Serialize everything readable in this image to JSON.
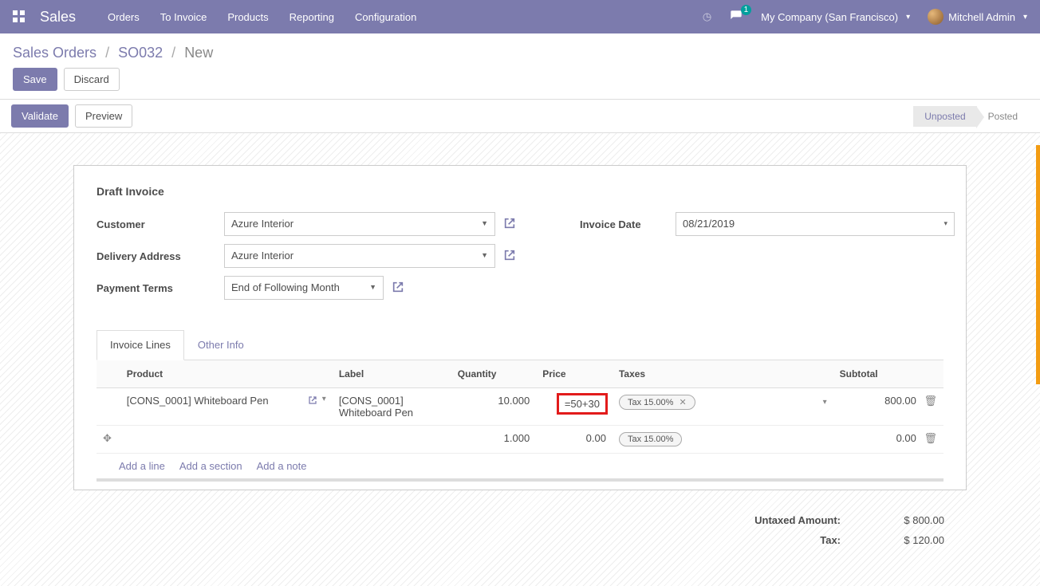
{
  "navbar": {
    "brand": "Sales",
    "menu": [
      "Orders",
      "To Invoice",
      "Products",
      "Reporting",
      "Configuration"
    ],
    "chat_badge": "1",
    "company": "My Company (San Francisco)",
    "user": "Mitchell Admin"
  },
  "breadcrumb": {
    "root": "Sales Orders",
    "so": "SO032",
    "current": "New"
  },
  "controls": {
    "save": "Save",
    "discard": "Discard"
  },
  "status": {
    "validate": "Validate",
    "preview": "Preview",
    "unposted": "Unposted",
    "posted": "Posted"
  },
  "sheet": {
    "title": "Draft Invoice",
    "labels": {
      "customer": "Customer",
      "delivery": "Delivery Address",
      "terms": "Payment Terms",
      "invoice_date": "Invoice Date"
    },
    "fields": {
      "customer": "Azure Interior",
      "delivery": "Azure Interior",
      "terms": "End of Following Month",
      "invoice_date": "08/21/2019"
    }
  },
  "tabs": {
    "lines": "Invoice Lines",
    "other": "Other Info"
  },
  "table": {
    "headers": {
      "product": "Product",
      "label": "Label",
      "quantity": "Quantity",
      "price": "Price",
      "taxes": "Taxes",
      "subtotal": "Subtotal"
    },
    "rows": [
      {
        "product": "[CONS_0001] Whiteboard Pen",
        "label": "[CONS_0001] Whiteboard Pen",
        "quantity": "10.000",
        "price": "=50+30",
        "tax": "Tax 15.00%",
        "tax_removable": true,
        "subtotal": "800.00",
        "price_highlight": true,
        "has_product": true
      },
      {
        "product": "",
        "label": "",
        "quantity": "1.000",
        "price": "0.00",
        "tax": "Tax 15.00%",
        "tax_removable": false,
        "subtotal": "0.00",
        "price_highlight": false,
        "has_product": false
      }
    ],
    "add": {
      "line": "Add a line",
      "section": "Add a section",
      "note": "Add a note"
    }
  },
  "totals": {
    "untaxed_lbl": "Untaxed Amount:",
    "untaxed_val": "$ 800.00",
    "tax_lbl": "Tax:",
    "tax_val": "$ 120.00"
  }
}
